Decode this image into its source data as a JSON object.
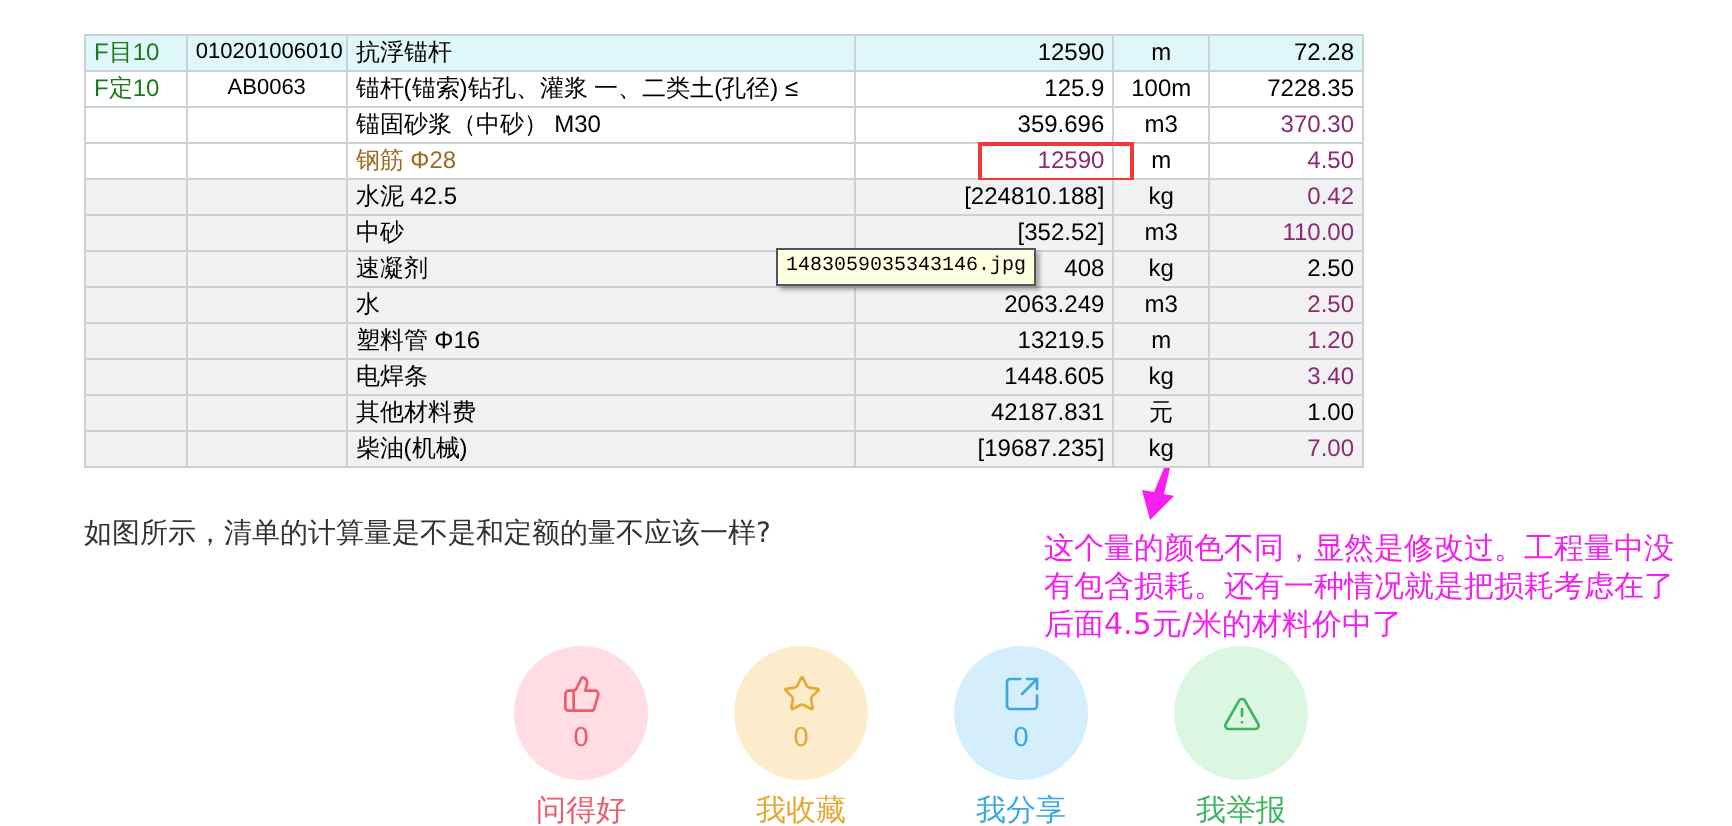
{
  "table": {
    "rows": [
      {
        "kind": "highlighted",
        "code": "F目10",
        "number": "010201006010",
        "name": "抗浮锚杆",
        "name_marked": false,
        "quantity": "12590",
        "quantity_marked": false,
        "boxed": false,
        "unit": "m",
        "price": "72.28",
        "price_marked": false
      },
      {
        "kind": "plain",
        "code": "F定10",
        "number": "AB0063",
        "name": "锚杆(锚索)钻孔、灌浆 一、二类土(孔径) ≤",
        "name_marked": false,
        "quantity": "125.9",
        "quantity_marked": false,
        "boxed": false,
        "unit": "100m",
        "price": "7228.35",
        "price_marked": false
      },
      {
        "kind": "plain",
        "name": "锚固砂浆（中砂） M30",
        "name_marked": false,
        "quantity": "359.696",
        "quantity_marked": false,
        "boxed": false,
        "unit": "m3",
        "price": "370.30",
        "price_marked": true
      },
      {
        "kind": "plain",
        "name": "钢筋 Φ28",
        "name_marked": true,
        "quantity": "12590",
        "quantity_marked": true,
        "boxed": true,
        "unit": "m",
        "price": "4.50",
        "price_marked": true
      },
      {
        "kind": "shaded",
        "name": "水泥 42.5",
        "name_marked": false,
        "quantity": "[224810.188]",
        "quantity_marked": false,
        "boxed": false,
        "unit": "kg",
        "price": "0.42",
        "price_marked": true
      },
      {
        "kind": "shaded",
        "name": "中砂",
        "name_marked": false,
        "quantity": "[352.52]",
        "quantity_marked": false,
        "boxed": false,
        "unit": "m3",
        "price": "110.00",
        "price_marked": true
      },
      {
        "kind": "shaded",
        "name": "速凝剂",
        "name_marked": false,
        "quantity": "408",
        "quantity_marked": false,
        "boxed": false,
        "unit": "kg",
        "price": "2.50",
        "price_marked": false
      },
      {
        "kind": "shaded",
        "name": "水",
        "name_marked": false,
        "quantity": "2063.249",
        "quantity_marked": false,
        "boxed": false,
        "unit": "m3",
        "price": "2.50",
        "price_marked": true
      },
      {
        "kind": "shaded",
        "name": "塑料管 Φ16",
        "name_marked": false,
        "quantity": "13219.5",
        "quantity_marked": false,
        "boxed": false,
        "unit": "m",
        "price": "1.20",
        "price_marked": true
      },
      {
        "kind": "shaded",
        "name": "电焊条",
        "name_marked": false,
        "quantity": "1448.605",
        "quantity_marked": false,
        "boxed": false,
        "unit": "kg",
        "price": "3.40",
        "price_marked": true
      },
      {
        "kind": "shaded",
        "name": "其他材料费",
        "name_marked": false,
        "quantity": "42187.831",
        "quantity_marked": false,
        "boxed": false,
        "unit": "元",
        "price": "1.00",
        "price_marked": false
      },
      {
        "kind": "shaded",
        "name": "柴油(机械)",
        "name_marked": false,
        "quantity": "[19687.235]",
        "quantity_marked": false,
        "boxed": false,
        "unit": "kg",
        "price": "7.00",
        "price_marked": true
      }
    ],
    "tooltip": "1483059035343146.jpg"
  },
  "question": "如图所示，清单的计算量是不是和定额的量不应该一样?",
  "annotation": "这个量的颜色不同，显然是修改过。工程量中没有包含损耗。还有一种情况就是把损耗考虑在了后面4.5元/米的材料价中了",
  "actions": [
    {
      "kind": "like",
      "label": "问得好",
      "count": "0"
    },
    {
      "kind": "favorite",
      "label": "我收藏",
      "count": "0"
    },
    {
      "kind": "share",
      "label": "我分享",
      "count": "0"
    },
    {
      "kind": "report",
      "label": "我举报"
    }
  ]
}
